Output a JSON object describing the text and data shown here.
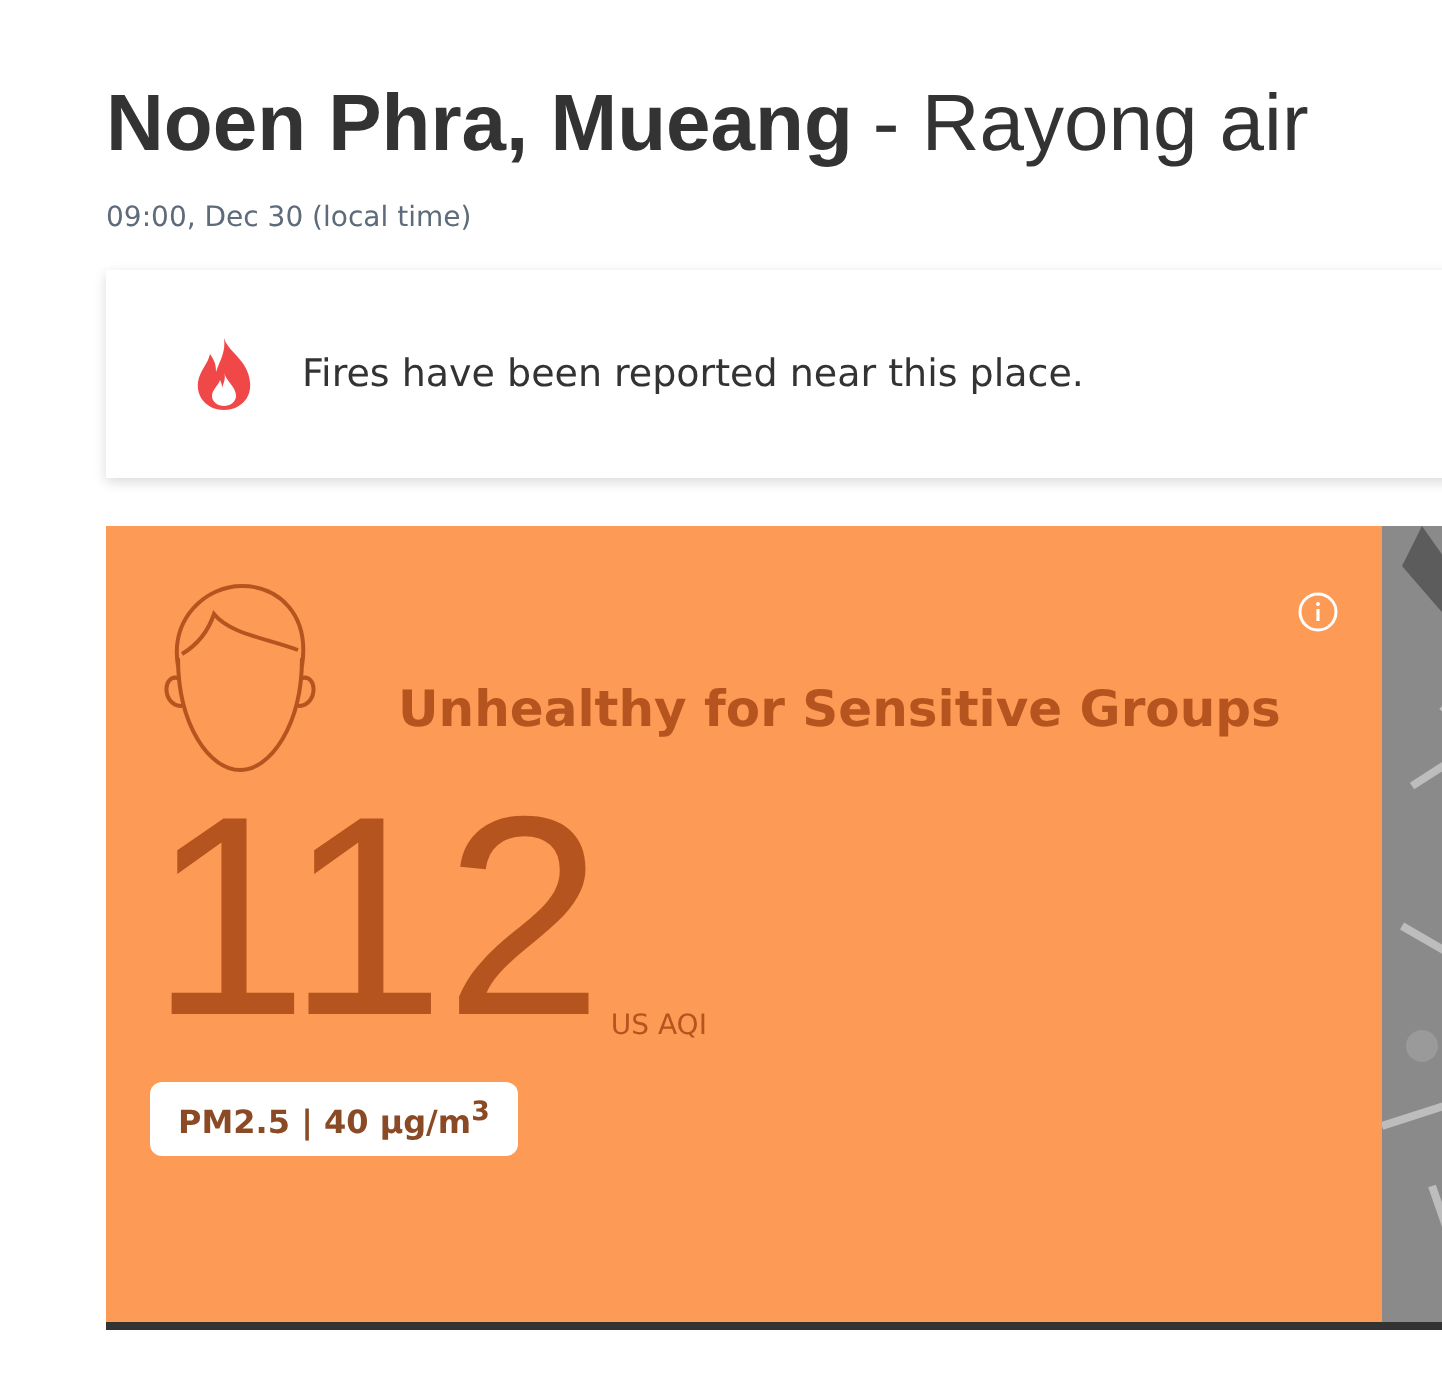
{
  "title": {
    "place": "Noen Phra, Mueang",
    "suffix": "- Rayong air"
  },
  "timestamp": "09:00, Dec 30 (local time)",
  "alert": {
    "kind": "fire",
    "text": "Fires have been reported near this place."
  },
  "aqi": {
    "status": "Unhealthy for Sensitive Groups",
    "value": "112",
    "unit": "US AQI",
    "pollutant": "PM2.5 | 40 µg/m$^{3}$"
  }
}
